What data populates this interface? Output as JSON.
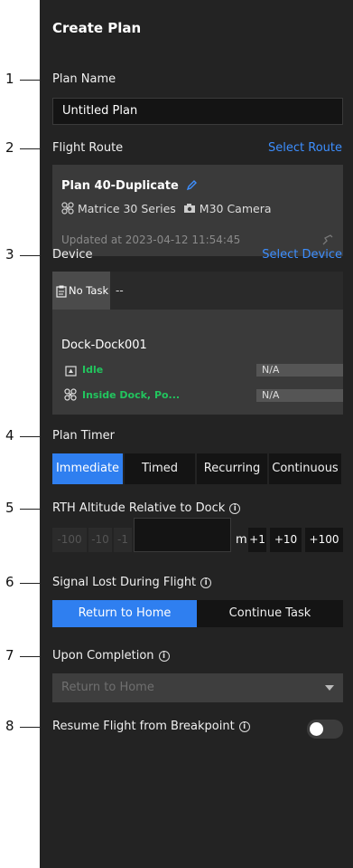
{
  "annotations": [
    "1",
    "2",
    "3",
    "4",
    "5",
    "6",
    "7",
    "8"
  ],
  "header": {
    "title": "Create Plan"
  },
  "plan_name": {
    "label": "Plan Name",
    "value": "Untitled Plan"
  },
  "flight_route": {
    "label": "Flight Route",
    "link": "Select Route",
    "route_name": "Plan 40-Duplicate",
    "aircraft": "Matrice 30 Series",
    "camera": "M30 Camera",
    "updated": "Updated at 2023-04-12 11:54:45"
  },
  "device": {
    "label": "Device",
    "link": "Select Device",
    "task_tab": "No Task",
    "task_value": "--",
    "dock_name": "Dock-Dock001",
    "dock_status": "Idle",
    "dock_value": "N/A",
    "aircraft_status": "Inside Dock, Po...",
    "aircraft_value": "N/A"
  },
  "plan_timer": {
    "label": "Plan Timer",
    "options": [
      "Immediate",
      "Timed",
      "Recurring",
      "Continuous"
    ],
    "selected": "Immediate"
  },
  "rth_altitude": {
    "label": "RTH Altitude Relative to Dock",
    "value": "",
    "unit": "m",
    "decrements": [
      "-100",
      "-10",
      "-1"
    ],
    "increments": [
      "+1",
      "+10",
      "+100"
    ]
  },
  "signal_lost": {
    "label": "Signal Lost During Flight",
    "options": [
      "Return to Home",
      "Continue Task"
    ],
    "selected": "Return to Home"
  },
  "upon_completion": {
    "label": "Upon Completion",
    "placeholder": "Return to Home"
  },
  "resume_flight": {
    "label": "Resume Flight from Breakpoint",
    "enabled": false
  },
  "colors": {
    "panel": "#232323",
    "accent": "#2f7ff0",
    "link": "#3d8fff",
    "status_green": "#22c55e"
  }
}
